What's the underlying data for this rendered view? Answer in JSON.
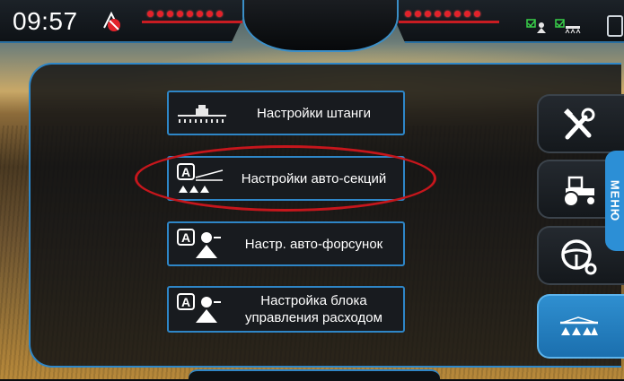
{
  "status_bar": {
    "time": "09:57",
    "left_indicator_count": 8,
    "right_indicator_count": 8,
    "indicator_color": "#e2222a",
    "icons": [
      "gps-off-icon",
      "section-status-icon",
      "boom-status-icon",
      "device-icon"
    ]
  },
  "menu": {
    "buttons": [
      {
        "label": "Настройки штанги",
        "icon": "boom-sprayer-icon"
      },
      {
        "label": "Настройки авто-секций",
        "icon": "auto-section-icon"
      },
      {
        "label": "Настр. авто-форсунок",
        "icon": "auto-nozzle-icon"
      },
      {
        "label_line1": "Настройка блока",
        "label_line2": "управления расходом",
        "icon": "flow-control-icon"
      }
    ],
    "highlighted_index": 1
  },
  "side_tabs": {
    "label": "МЕНЮ",
    "items": [
      {
        "icon": "tools-icon",
        "active": false
      },
      {
        "icon": "tractor-icon",
        "active": false
      },
      {
        "icon": "steering-settings-icon",
        "active": false
      },
      {
        "icon": "sprayer-icon",
        "active": true
      }
    ],
    "active_color": "#2f8fd0"
  },
  "colors": {
    "accent": "#2e86c7",
    "highlight": "#c6161c"
  }
}
